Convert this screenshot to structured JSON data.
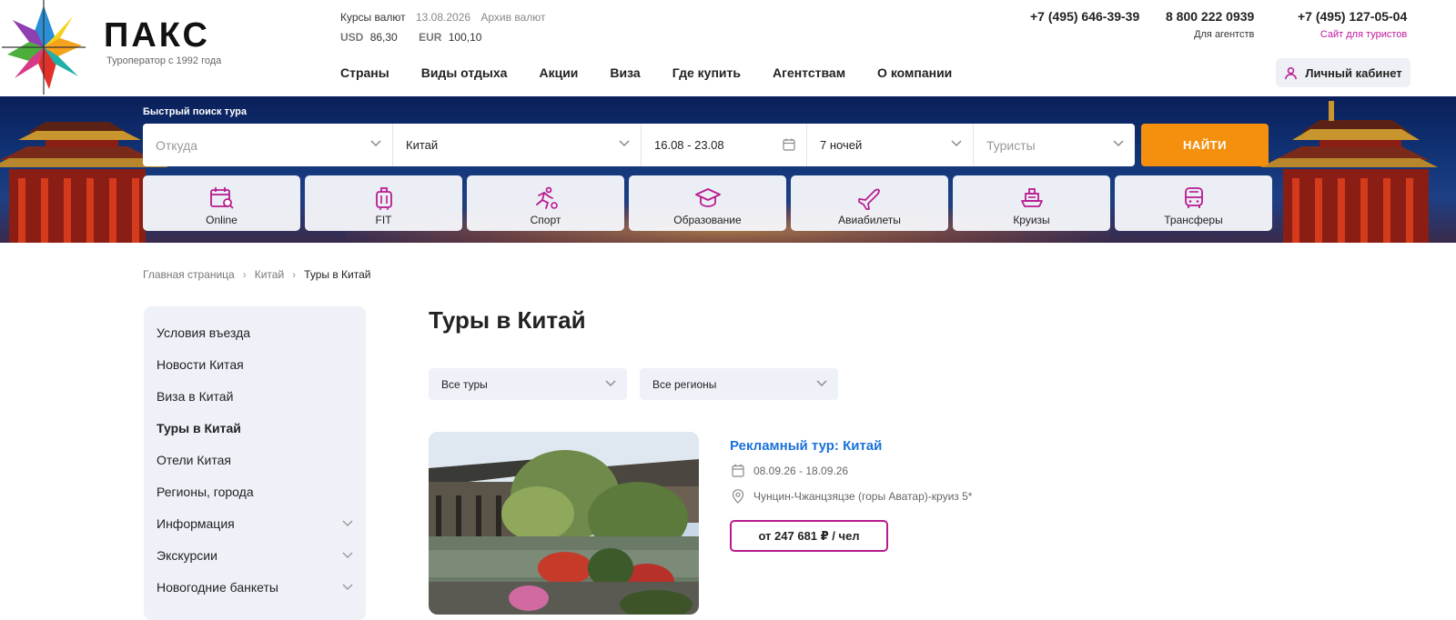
{
  "brand": {
    "name": "ПАКС",
    "tagline": "Туроператор с 1992 года"
  },
  "rates": {
    "label": "Курсы валют",
    "date": "13.08.2026",
    "archive": "Архив валют",
    "usd_code": "USD",
    "usd_value": "86,30",
    "eur_code": "EUR",
    "eur_value": "100,10"
  },
  "nav": [
    "Страны",
    "Виды отдыха",
    "Акции",
    "Виза",
    "Где купить",
    "Агентствам",
    "О компании"
  ],
  "phones": [
    {
      "number": "+7 (495) 646-39-39",
      "sub": ""
    },
    {
      "number": "8 800 222 0939",
      "sub": "Для агентств"
    },
    {
      "number": "+7 (495) 127-05-04",
      "sub": "Сайт для туристов"
    }
  ],
  "cabinet_label": "Личный кабинет",
  "search": {
    "label": "Быстрый поиск тура",
    "from_placeholder": "Откуда",
    "country": "Китай",
    "dates": "16.08 - 23.08",
    "nights": "7 ночей",
    "tourists_placeholder": "Туристы",
    "button": "НАЙТИ"
  },
  "categories": [
    {
      "label": "Online",
      "icon": "calendar-search-icon"
    },
    {
      "label": "FIT",
      "icon": "suitcase-icon"
    },
    {
      "label": "Спорт",
      "icon": "runner-icon"
    },
    {
      "label": "Образование",
      "icon": "graduation-cap-icon"
    },
    {
      "label": "Авиабилеты",
      "icon": "airplane-icon"
    },
    {
      "label": "Круизы",
      "icon": "ship-icon"
    },
    {
      "label": "Трансферы",
      "icon": "bus-icon"
    }
  ],
  "breadcrumbs": [
    "Главная страница",
    "Китай",
    "Туры в Китай"
  ],
  "sidebar": [
    {
      "label": "Условия въезда",
      "expandable": false
    },
    {
      "label": "Новости Китая",
      "expandable": false
    },
    {
      "label": "Виза в Китай",
      "expandable": false
    },
    {
      "label": "Туры в Китай",
      "expandable": false
    },
    {
      "label": "Отели Китая",
      "expandable": false
    },
    {
      "label": "Регионы, города",
      "expandable": false
    },
    {
      "label": "Информация",
      "expandable": true
    },
    {
      "label": "Экскурсии",
      "expandable": true
    },
    {
      "label": "Новогодние банкеты",
      "expandable": true
    }
  ],
  "page_title": "Туры в Китай",
  "filters": {
    "tours": "Все туры",
    "regions": "Все регионы"
  },
  "tour": {
    "title": "Рекламный тур: Китай",
    "dates": "08.09.26 - 18.09.26",
    "location": "Чунцин-Чжанцзяцзе (горы Аватар)-круиз 5*",
    "price": "от 247 681 ₽ / чел"
  },
  "colors": {
    "accent_pink": "#b81a8f",
    "link_blue": "#1a72d9",
    "button_orange": "#f4900e",
    "hero_blue": "#123679"
  }
}
